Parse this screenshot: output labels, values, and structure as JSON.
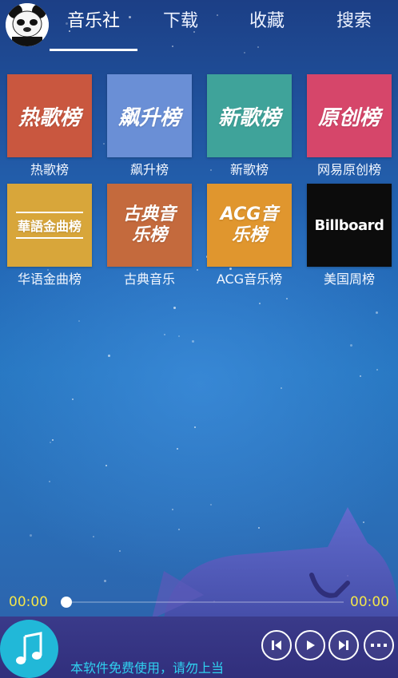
{
  "header": {
    "tabs": [
      {
        "label": "音乐社"
      },
      {
        "label": "下载"
      },
      {
        "label": "收藏"
      },
      {
        "label": "搜索"
      }
    ]
  },
  "charts": [
    {
      "label": "热歌榜",
      "logo": "热歌榜",
      "color": "#c9573f"
    },
    {
      "label": "飙升榜",
      "logo": "飙升榜",
      "color": "#6a8fd6"
    },
    {
      "label": "新歌榜",
      "logo": "新歌榜",
      "color": "#3fa39a"
    },
    {
      "label": "网易原创榜",
      "logo": "原创榜",
      "color": "#d6466a"
    },
    {
      "label": "华语金曲榜",
      "logo": "華語金曲榜",
      "color": "#d8a63a"
    },
    {
      "label": "古典音乐",
      "logo": "古典音乐榜",
      "color": "#c46a3d"
    },
    {
      "label": "ACG音乐榜",
      "logo": "ACG音乐榜",
      "color": "#e0962e"
    },
    {
      "label": "美国周榜",
      "logo": "Billboard",
      "color": "#0c0c0c"
    }
  ],
  "progress": {
    "current": "00:00",
    "total": "00:00",
    "fraction": 0
  },
  "player": {
    "hint": "本软件免费使用，请勿上当"
  }
}
